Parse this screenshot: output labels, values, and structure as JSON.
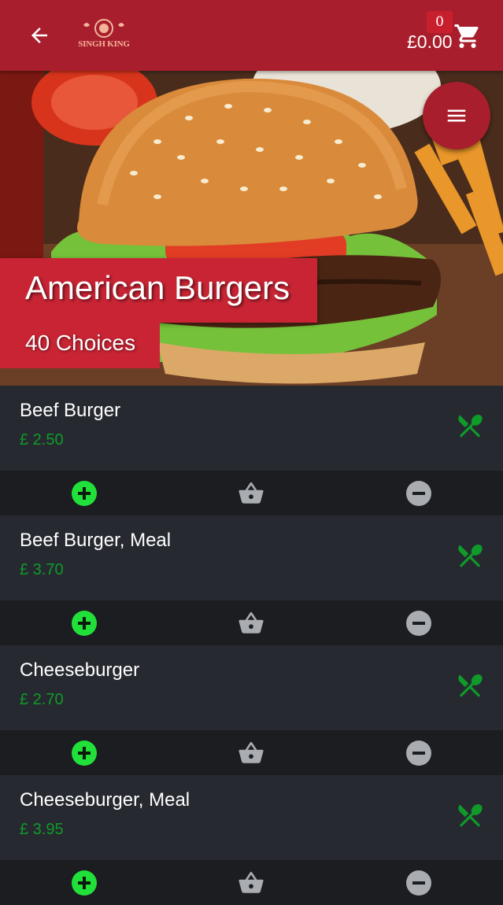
{
  "header": {
    "logo_text": "SINGH KING",
    "cart_count": "0",
    "cart_total": "£0.00"
  },
  "hero": {
    "title": "American Burgers",
    "subtitle": "40 Choices"
  },
  "items": [
    {
      "name": "Beef Burger",
      "price": "£ 2.50"
    },
    {
      "name": "Beef Burger, Meal",
      "price": "£ 3.70"
    },
    {
      "name": "Cheeseburger",
      "price": "£ 2.70"
    },
    {
      "name": "Cheeseburger, Meal",
      "price": "£ 3.95"
    }
  ],
  "icons": {
    "back": "arrow-left-icon",
    "cart": "shopping-cart-icon",
    "menu": "hamburger-menu-icon",
    "item_type": "fork-spoon-icon",
    "add": "plus-circle-icon",
    "basket": "basket-icon",
    "remove": "minus-circle-icon"
  },
  "colors": {
    "brand_red": "#a81e2c",
    "title_red": "#c82434",
    "price_green": "#0f9a2a",
    "add_green": "#22e03a",
    "remove_grey": "#a9acb1",
    "background": "#23262b"
  }
}
